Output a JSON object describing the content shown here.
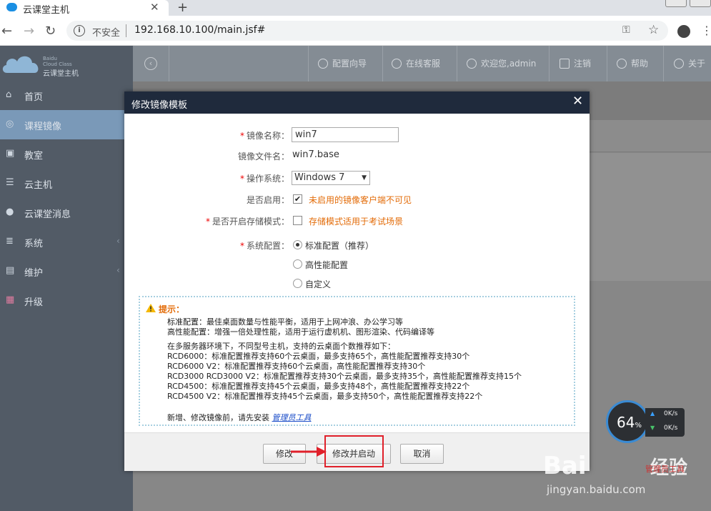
{
  "browser": {
    "tab_title": "云课堂主机",
    "security": "不安全",
    "url": "192.168.10.100/main.jsf#"
  },
  "app": {
    "logo_en": "Baidu\nCloud Class",
    "logo_cn": "云课堂主机",
    "menu": [
      {
        "label": "首页",
        "icon": "home-icon"
      },
      {
        "label": "课程镜像",
        "icon": "disc-icon",
        "active": true
      },
      {
        "label": "教室",
        "icon": "classroom-icon"
      },
      {
        "label": "云主机",
        "icon": "server-icon"
      },
      {
        "label": "云课堂消息",
        "icon": "message-icon"
      },
      {
        "label": "系统",
        "icon": "system-icon",
        "arrow": true
      },
      {
        "label": "维护",
        "icon": "toolbox-icon",
        "arrow": true
      },
      {
        "label": "升级",
        "icon": "upgrade-icon"
      }
    ],
    "header": {
      "wizard": "配置向导",
      "support": "在线客服",
      "welcome": "欢迎您,admin",
      "logout": "注销",
      "help": "帮助",
      "about": "关于"
    }
  },
  "modal": {
    "title": "修改镜像模板",
    "close": "✕",
    "fields": {
      "name_label": "镜像名称：",
      "name_value": "win7",
      "file_label": "镜像文件名：",
      "file_value": "win7.base",
      "os_label": "操作系统：",
      "os_value": "Windows 7",
      "enabled_label": "是否启用：",
      "enabled_hint": "未启用的镜像客户端不可见",
      "storage_label": "是否开启存储模式：",
      "storage_hint": "存储模式适用于考试场景",
      "config_label": "系统配置：",
      "config_options": [
        "标准配置（推荐）",
        "高性能配置",
        "自定义"
      ]
    },
    "tip": {
      "title": "提示：",
      "lines_a": [
        "标准配置：最佳桌面数量与性能平衡，适用于上网冲浪、办公学习等",
        "高性能配置：增强一倍处理性能，适用于运行虚机机、图形渲染、代码编译等"
      ],
      "lines_b": [
        "在多服务器环境下，不同型号主机，支持的云桌面个数推荐如下：",
        "RCD6000：标准配置推荐支持60个云桌面，最多支持65个，高性能配置推荐支持30个",
        "RCD6000 V2：标准配置推荐支持60个云桌面，高性能配置推荐支持30个",
        "RCD3000 RCD3000 V2：标准配置推荐支持30个云桌面，最多支持35个，高性能配置推荐支持15个",
        "RCD4500：标准配置推荐支持45个云桌面，最多支持48个，高性能配置推荐支持22个",
        "RCD4500 V2：标准配置推荐支持45个云桌面，最多支持50个，高性能配置推荐支持22个"
      ],
      "tool_prefix": "新增、修改镜像前，请先安装",
      "tool_link": "管理员工具"
    },
    "buttons": {
      "modify": "修改",
      "modify_start": "修改并启动",
      "cancel": "取消"
    }
  },
  "speed": {
    "percent": "64",
    "unit": "%",
    "up": "0K/s",
    "down": "0K/s"
  },
  "watermark": {
    "brand": "Bai",
    "brand_cn": "经验",
    "url": "jingyan.baidu.com",
    "tool": "管理员工具"
  }
}
